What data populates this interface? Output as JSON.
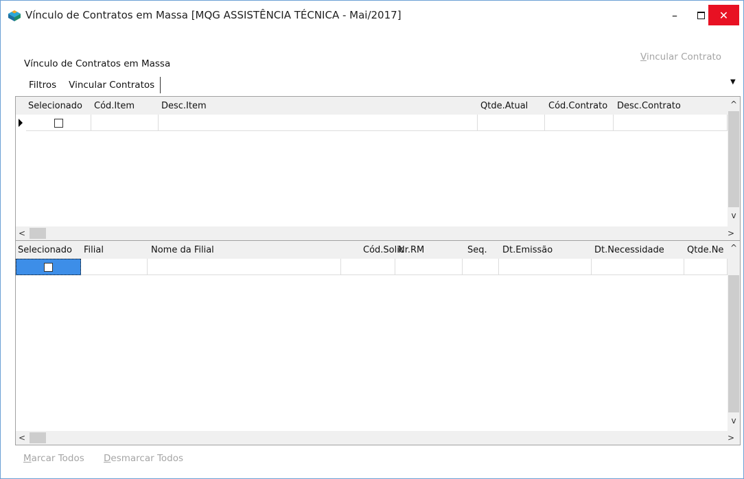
{
  "window": {
    "title": "Vínculo de Contratos em Massa [MQG ASSISTÊNCIA TÉCNICA - Mai/2017]",
    "minimize": "–",
    "close": "✕"
  },
  "page_title": "Vínculo de Contratos em Massa",
  "vincular_contrato": {
    "mnemonic": "V",
    "rest": "incular Contrato"
  },
  "tabs": [
    {
      "label": "Filtros"
    },
    {
      "label": "Vincular Contratos"
    }
  ],
  "grid1": {
    "columns": [
      "Selecionado",
      "Cód.Item",
      "Desc.Item",
      "Qtde.Atual",
      "Cód.Contrato",
      "Desc.Contrato"
    ]
  },
  "grid2": {
    "columns": [
      "Selecionado",
      "Filial",
      "Nome da Filial",
      "Cód.Solic",
      "Nr.RM",
      "Seq.",
      "Dt.Emissão",
      "Dt.Necessidade",
      "Qtde.Ne"
    ]
  },
  "scroll_glyphs": {
    "up": "^",
    "down": "v",
    "left": "<",
    "right": ">"
  },
  "footer": {
    "marcar": {
      "mnemonic": "M",
      "rest": "arcar Todos"
    },
    "desmarcar": {
      "mnemonic": "D",
      "rest": "esmarcar Todos"
    }
  },
  "colors": {
    "border": "#6a9fd4",
    "close": "#e81123",
    "selected": "#3d8ee8",
    "disabled_text": "#a5a5a5"
  }
}
